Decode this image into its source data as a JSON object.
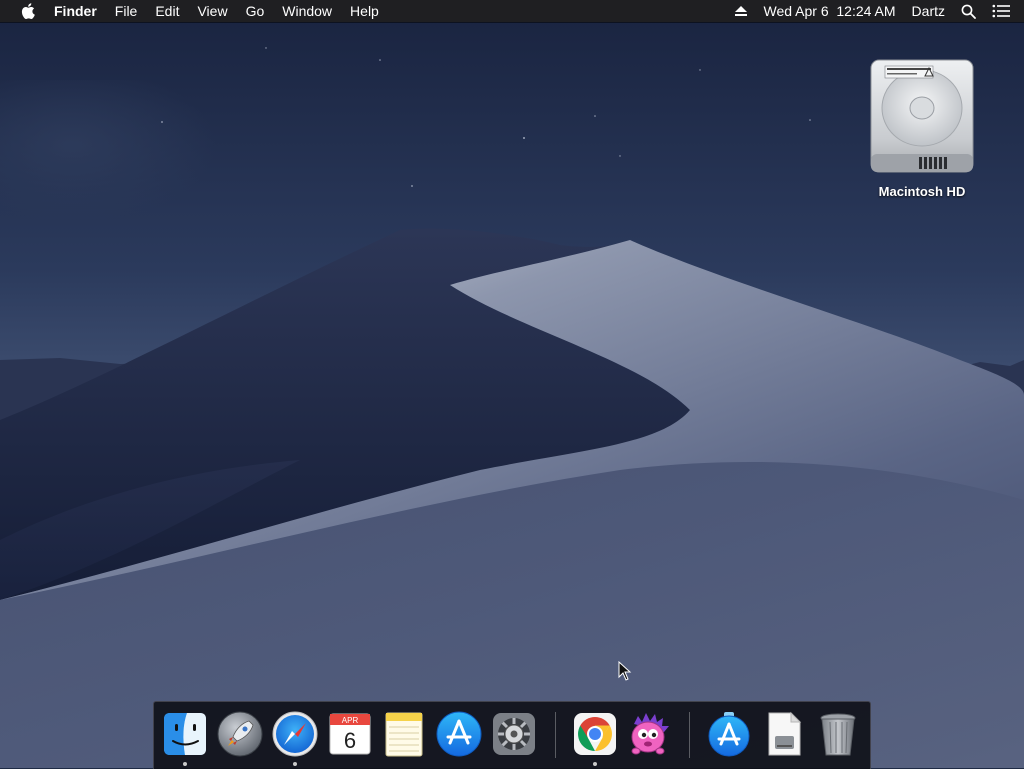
{
  "menubar": {
    "apple_icon": "apple-logo-icon",
    "app_name": "Finder",
    "menus": [
      "File",
      "Edit",
      "View",
      "Go",
      "Window",
      "Help"
    ],
    "status": {
      "eject_icon": "eject-icon",
      "datetime": "Wed Apr 6  12:24 AM",
      "user": "Dartz",
      "spotlight_icon": "search-icon",
      "notification_icon": "list-icon"
    }
  },
  "desktop": {
    "wallpaper": "Mojave night dune",
    "icons": [
      {
        "label": "Macintosh HD",
        "icon": "hard-drive-icon"
      }
    ]
  },
  "dock": {
    "apps": [
      {
        "id": "finder",
        "icon": "finder-icon",
        "running": true
      },
      {
        "id": "launchpad",
        "icon": "launchpad-rocket-icon",
        "running": false
      },
      {
        "id": "safari",
        "icon": "safari-compass-icon",
        "running": true
      },
      {
        "id": "calendar",
        "icon": "calendar-icon",
        "running": false,
        "month": "APR",
        "day": "6"
      },
      {
        "id": "notes",
        "icon": "notes-icon",
        "running": false
      },
      {
        "id": "app-store",
        "icon": "app-store-icon",
        "running": false
      },
      {
        "id": "system-preferences",
        "icon": "gear-icon",
        "running": false
      },
      {
        "id": "chrome",
        "icon": "chrome-icon",
        "running": true
      },
      {
        "id": "pink-creature-app",
        "icon": "pink-creature-icon",
        "running": false
      }
    ],
    "others": [
      {
        "id": "app-store-download",
        "icon": "app-store-download-icon"
      },
      {
        "id": "document",
        "icon": "document-icon"
      },
      {
        "id": "trash",
        "icon": "trash-icon"
      }
    ]
  },
  "colors": {
    "menubar_bg": "#1f1f22",
    "menubar_text": "#ffffff",
    "sky_top": "#1b2540",
    "sky_bottom": "#50607e",
    "dune_dark": "#1e2848",
    "dune_light": "#8a93a8"
  }
}
